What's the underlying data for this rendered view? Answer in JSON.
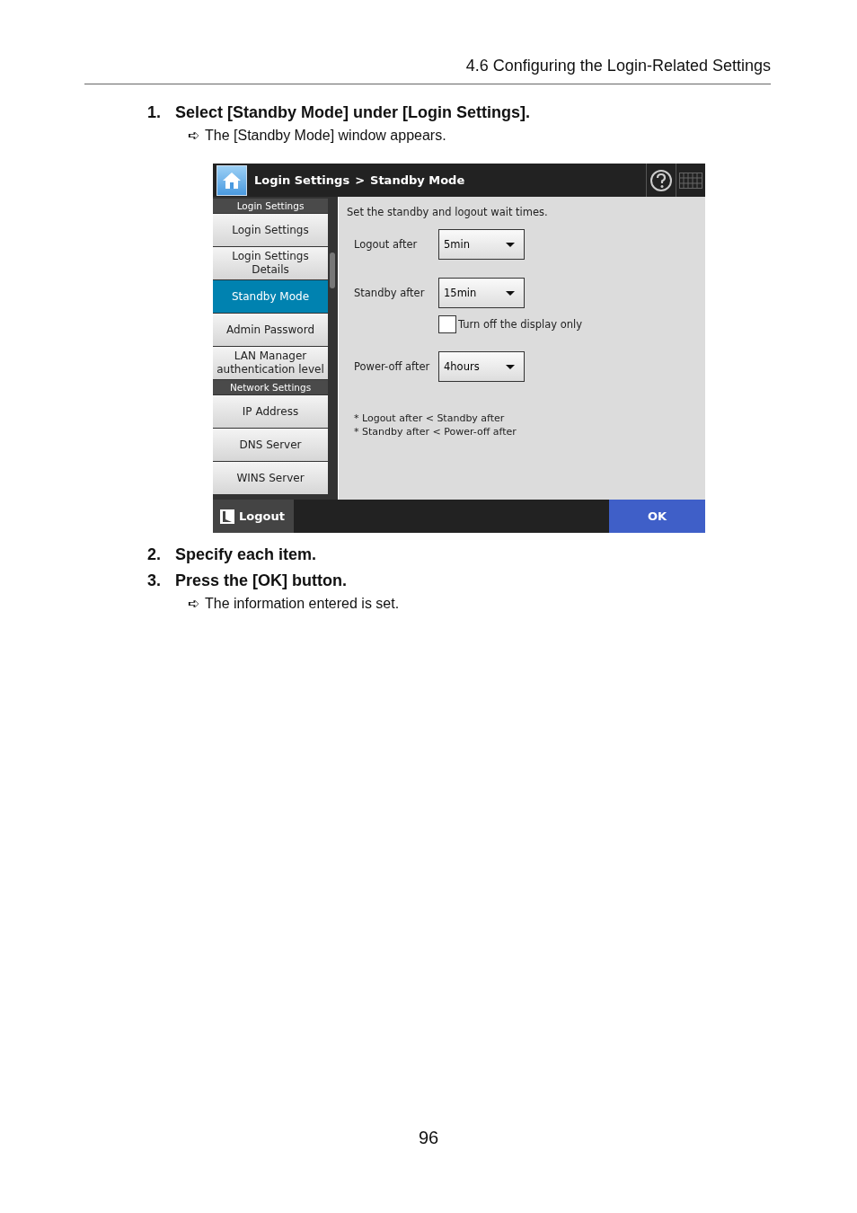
{
  "page_header": {
    "title": "4.6 Configuring the Login-Related Settings"
  },
  "blocks": [
    {
      "kind": "step",
      "number": "1.",
      "text": "Select [Standby Mode] under [Login Settings]."
    },
    {
      "kind": "result",
      "arrow": "➪",
      "text": "The [Standby Mode] window appears."
    },
    {
      "kind": "screen"
    },
    {
      "kind": "step",
      "number": "2.",
      "text": "Specify each item."
    },
    {
      "kind": "step",
      "number": "3.",
      "text": "Press the [OK] button."
    },
    {
      "kind": "result",
      "arrow": "➪",
      "text": "The information entered is set."
    }
  ],
  "screen": {
    "title_bar": {
      "crumbs": [
        "Login Settings",
        "Standby Mode"
      ],
      "separator": ">"
    },
    "sidebar": {
      "items": [
        {
          "kind": "group",
          "label": "Login Settings"
        },
        {
          "kind": "item",
          "label": "Login Settings",
          "selected": false
        },
        {
          "kind": "item",
          "label": "Login Settings Details",
          "selected": false
        },
        {
          "kind": "item",
          "label": "Standby Mode",
          "selected": true
        },
        {
          "kind": "item",
          "label": "Admin Password",
          "selected": false
        },
        {
          "kind": "item",
          "label": "LAN Manager authentication level",
          "selected": false
        },
        {
          "kind": "group",
          "label": "Network Settings"
        },
        {
          "kind": "item",
          "label": "IP Address",
          "selected": false
        },
        {
          "kind": "item",
          "label": "DNS Server",
          "selected": false
        },
        {
          "kind": "item",
          "label": "WINS Server",
          "selected": false
        }
      ]
    },
    "panel": {
      "instruction": "Set the standby and logout wait times.",
      "fields": [
        {
          "kind": "dropdown",
          "label": "Logout after",
          "value": "5min"
        },
        {
          "kind": "dropdown",
          "label": "Standby after",
          "value": "15min"
        },
        {
          "kind": "checkbox",
          "label": "Turn off the display only",
          "checked": false
        },
        {
          "kind": "dropdown",
          "label": "Power-off after",
          "value": "4hours"
        }
      ],
      "notes": [
        "* Logout after < Standby after",
        "* Standby after < Power-off after"
      ]
    },
    "footer": {
      "logout": "Logout",
      "ok": "OK"
    }
  },
  "page_number": "96"
}
